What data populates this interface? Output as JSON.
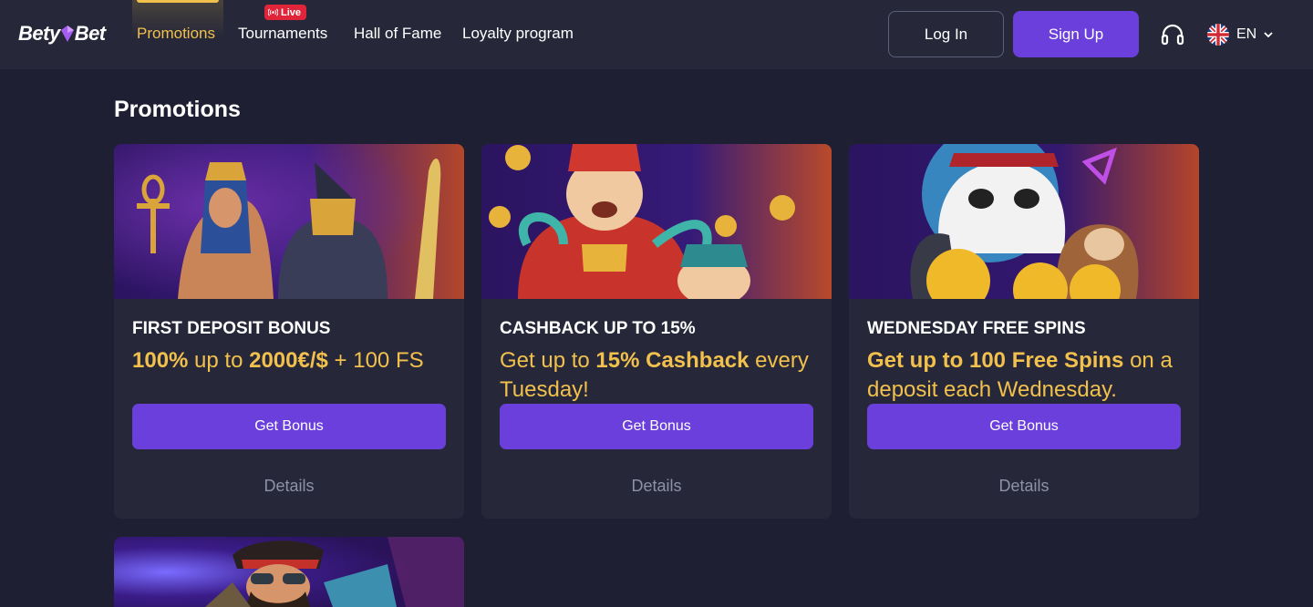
{
  "header": {
    "logo_part1": "Bety",
    "logo_part2": "Bet",
    "nav": [
      {
        "label": "Promotions",
        "active": true
      },
      {
        "label": "Tournaments",
        "badge": "Live"
      },
      {
        "label": "Hall of Fame"
      },
      {
        "label": "Loyalty program"
      }
    ],
    "login_label": "Log In",
    "signup_label": "Sign Up",
    "language": "EN"
  },
  "main": {
    "title": "Promotions",
    "cards": [
      {
        "title": "FIRST DEPOSIT BONUS",
        "desc_parts": [
          "100%",
          " up to ",
          "2000€/$",
          " + 100 FS"
        ],
        "button": "Get Bonus",
        "details": "Details"
      },
      {
        "title": "CASHBACK UP TO 15%",
        "desc_parts": [
          "Get up to ",
          "15% Cashback",
          " every Tuesday!"
        ],
        "button": "Get Bonus",
        "details": "Details"
      },
      {
        "title": "WEDNESDAY FREE SPINS",
        "desc_parts": [
          "Get up to 100 Free Spins",
          " on a deposit each Wednesday."
        ],
        "button": "Get Bonus",
        "details": "Details"
      }
    ]
  },
  "colors": {
    "background": "#1e1f33",
    "header": "#262839",
    "card": "#26283a",
    "accent": "#6a3fdc",
    "gold": "#f2c04c",
    "live": "#e0243a"
  },
  "icons": [
    "headset-icon",
    "uk-flag-icon",
    "chevron-down-icon",
    "broadcast-icon"
  ]
}
